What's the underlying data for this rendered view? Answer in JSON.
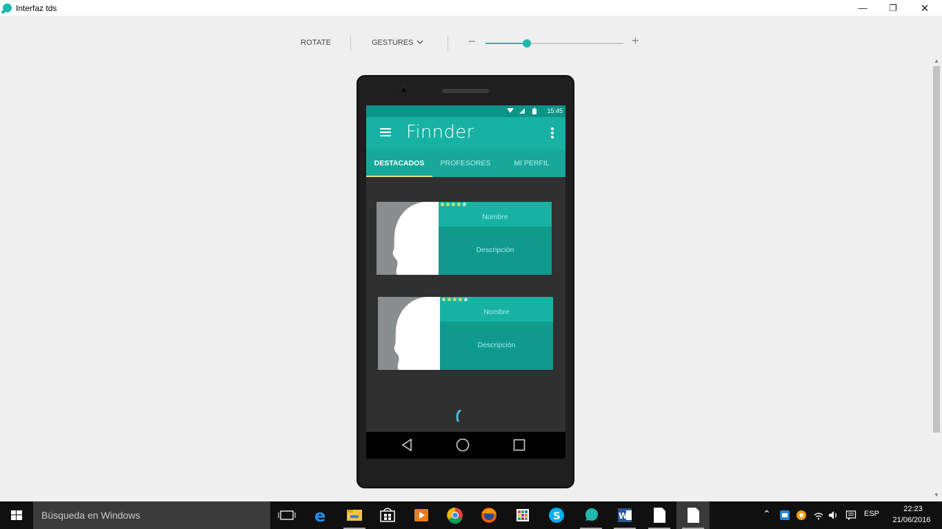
{
  "window": {
    "title": "Interfaz tds",
    "minimize_glyph": "—",
    "restore_glyph": "❐",
    "close_glyph": "✕",
    "icon": "emulator-app-icon"
  },
  "toolbar": {
    "rotate_label": "ROTATE",
    "gestures_label": "GESTURES",
    "zoom_minus": "−",
    "zoom_plus": "+",
    "zoom_level_fraction": 0.3
  },
  "phone": {
    "status_time": "15:45",
    "app_title": "Finnder",
    "tabs": [
      {
        "label": "DESTACADOS",
        "active": true
      },
      {
        "label": "PROFESORES",
        "active": false
      },
      {
        "label": "MI PERFIL",
        "active": false
      }
    ],
    "cards": [
      {
        "stars": "★★★★",
        "star_empty": "★",
        "rating": 4,
        "name": "Nombre",
        "description": "Descripción"
      },
      {
        "stars": "★★★★",
        "star_empty": "★",
        "rating": 4,
        "name": "Nombre",
        "description": "Descripción"
      }
    ],
    "colors": {
      "statusbar": "#0d9488",
      "appbar": "#17b2a3",
      "tabs": "#17a89a",
      "tab_indicator": "#e8e08a",
      "screen_bg": "#303030"
    }
  },
  "taskbar": {
    "search_placeholder": "Búsqueda en Windows",
    "pinned": [
      "task-view-icon",
      "edge-icon",
      "file-explorer-icon",
      "store-icon",
      "media-player-icon",
      "chrome-icon",
      "firefox-icon",
      "calculator-icon",
      "skype-icon",
      "emulator-app-icon",
      "word-icon",
      "document-icon",
      "document-icon"
    ],
    "language": "ESP",
    "time": "22:23",
    "date": "21/06/2016"
  }
}
